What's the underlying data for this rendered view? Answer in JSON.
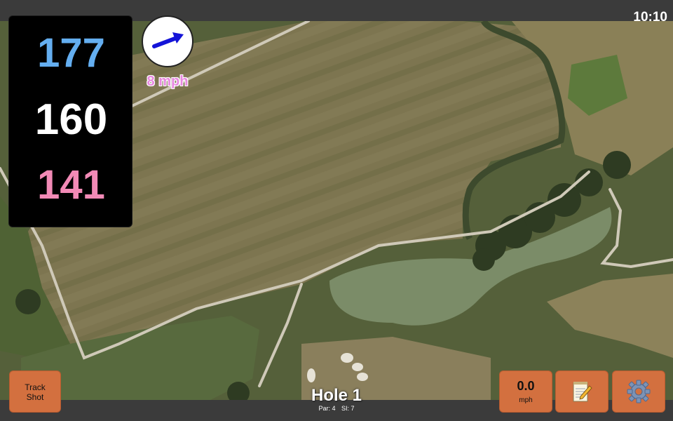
{
  "status_bar": {
    "time": "10:10"
  },
  "distances": {
    "back": "177",
    "middle": "160",
    "front": "141"
  },
  "wind": {
    "speed_label": "8 mph",
    "arrow_icon": "wind-direction-arrow-icon"
  },
  "buttons": {
    "track_shot_line1": "Track",
    "track_shot_line2": "Shot",
    "speed_value": "0.0",
    "speed_unit": "mph",
    "scorecard_icon": "notepad-pencil-icon",
    "settings_icon": "gear-icon"
  },
  "hole": {
    "title": "Hole 1",
    "par_label": "Par: 4",
    "si_label": "SI: 7"
  },
  "colors": {
    "back_distance": "#64aef0",
    "middle_distance": "#ffffff",
    "front_distance": "#f28ab6",
    "wind_text": "#e889e0",
    "button_orange": "#d3703f",
    "wind_arrow": "#1414d8"
  }
}
